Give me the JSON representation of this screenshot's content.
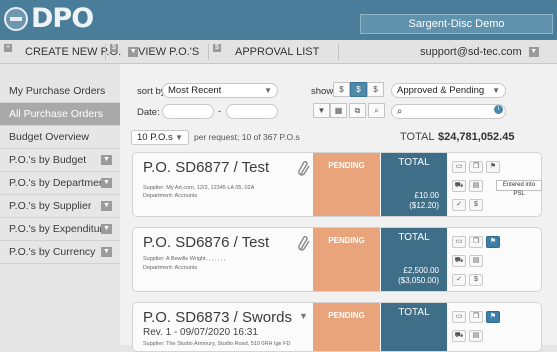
{
  "header": {
    "logo_text": "DPO",
    "org_button": "Sargent-Disc Demo"
  },
  "menu": {
    "create": "CREATE NEW P.O.",
    "view": "VIEW P.O.'S",
    "approval": "APPROVAL LIST",
    "user": "support@sd-tec.com",
    "create_icon": "+",
    "money_icon": "$"
  },
  "sidebar": {
    "items": [
      {
        "label": "My Purchase Orders",
        "has_dropdown": false
      },
      {
        "label": "All Purchase Orders",
        "active": true,
        "has_dropdown": false
      },
      {
        "label": "Budget Overview",
        "has_dropdown": false
      },
      {
        "label": "P.O.'s by Budget",
        "has_dropdown": true
      },
      {
        "label": "P.O.'s by Department",
        "has_dropdown": true
      },
      {
        "label": "P.O.'s by Supplier",
        "has_dropdown": true
      },
      {
        "label": "P.O.'s by Expenditure Type",
        "has_dropdown": true
      },
      {
        "label": "P.O.'s by Currency",
        "has_dropdown": true
      }
    ]
  },
  "filters": {
    "sort_label": "sort by:",
    "sort_value": "Most Recent",
    "date_label": "Date:",
    "date_sep": "-",
    "show_label": "show:",
    "status_value": "Approved & Pending",
    "per_page_value": "10 P.O.s",
    "per_page_text": "per request; 10 of 367 P.O.s",
    "total_label": "TOTAL",
    "total_value": "$24,781,052.45",
    "search_placeholder": ""
  },
  "cards": [
    {
      "title": "P.O. SD6877 / Test",
      "rev": "",
      "supplier": "Supplier: My Art.com, 12/3, 12345 LA 05, 02A",
      "department": "Department: Accounts",
      "status": "PENDING",
      "total_label": "TOTAL",
      "amount": "£10.00",
      "amount_alt": "($12.20)"
    },
    {
      "title": "P.O. SD6876 / Test",
      "rev": "",
      "supplier": "Supplier: A Bewille Wright, , , , , , ,",
      "department": "Department: Accounts",
      "status": "PENDING",
      "total_label": "TOTAL",
      "amount": "£2,500.00",
      "amount_alt": "($3,050.00)"
    },
    {
      "title": "P.O. SD6873 / Swords",
      "rev": "Rev. 1 - 09/07/2020 16:31",
      "supplier": "Supplier: The Studio Armoury, Studio Road, 510 0RH Ige FD",
      "department": "",
      "status": "PENDING",
      "total_label": "TOTAL",
      "amount": "",
      "amount_alt": ""
    }
  ],
  "tooltip": "Entered into PSL",
  "colors": {
    "header_blue": "#4a7d99",
    "pending_orange": "#e9a47c",
    "total_blue": "#3f6e89"
  }
}
